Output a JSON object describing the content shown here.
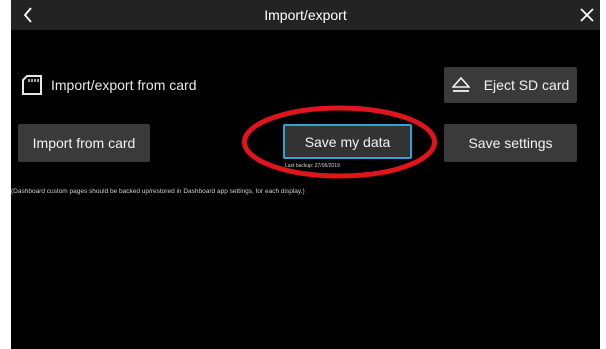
{
  "header": {
    "title": "Import/export",
    "back_icon": "chevron-left-icon",
    "close_icon": "close-icon"
  },
  "section": {
    "icon": "sd-card-icon",
    "label": "Import/export from card"
  },
  "buttons": {
    "eject": {
      "icon": "eject-icon",
      "label": "Eject SD card"
    },
    "import": {
      "label": "Import from card"
    },
    "save_data": {
      "label": "Save my data",
      "last_backup": "Last backup: 27/06/2019"
    },
    "save_settings": {
      "label": "Save settings"
    }
  },
  "note": "(Dashboard custom pages should be backed up/restored in Dashboard app settings, for each display.)",
  "colors": {
    "background": "#000000",
    "titlebar": "#232323",
    "button": "#3a3a3a",
    "focus_border": "#2ea3d6",
    "highlight_ring": "#e0141b"
  }
}
